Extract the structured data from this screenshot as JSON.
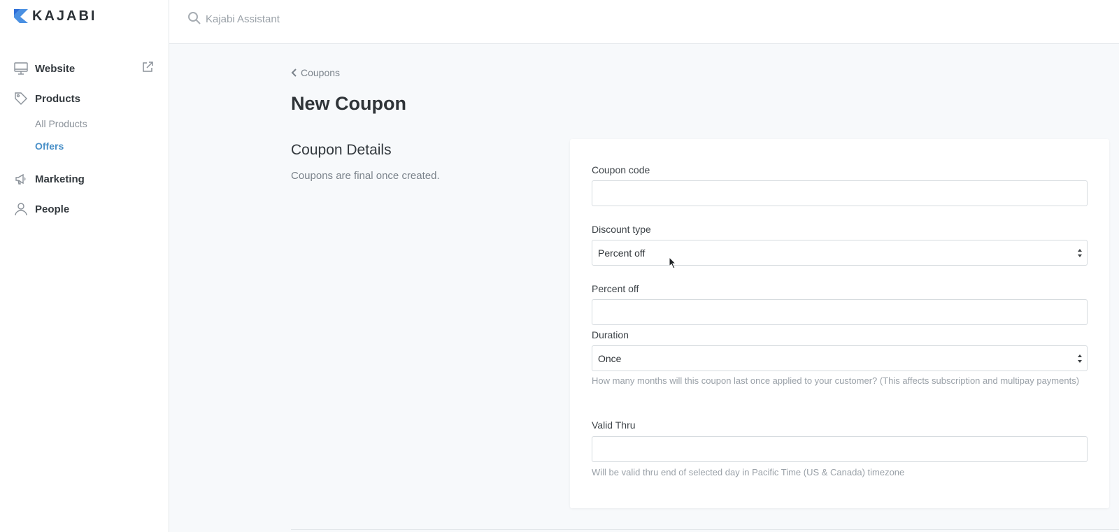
{
  "brand": {
    "name": "KAJABI",
    "color": "#4a90e2"
  },
  "search": {
    "placeholder": "Kajabi Assistant",
    "icon": "search-icon"
  },
  "sidebar": {
    "items": [
      {
        "label": "Website",
        "icon": "monitor-icon"
      },
      {
        "label": "Products",
        "icon": "tag-icon",
        "children": [
          {
            "label": "All Products"
          },
          {
            "label": "Offers",
            "active": true
          }
        ]
      },
      {
        "label": "Marketing",
        "icon": "megaphone-icon"
      },
      {
        "label": "People",
        "icon": "person-icon"
      }
    ]
  },
  "breadcrumb": {
    "label": "Coupons"
  },
  "page": {
    "title": "New Coupon",
    "section_title": "Coupon Details",
    "section_desc": "Coupons are final once created."
  },
  "form": {
    "coupon_code": {
      "label": "Coupon code",
      "value": ""
    },
    "discount_type": {
      "label": "Discount type",
      "value": "Percent off"
    },
    "percent_off": {
      "label": "Percent off",
      "value": ""
    },
    "duration": {
      "label": "Duration",
      "value": "Once",
      "help": "How many months will this coupon last once applied to your customer? (This affects subscription and multipay payments)"
    },
    "valid_thru": {
      "label": "Valid Thru",
      "value": "",
      "help": "Will be valid thru end of selected day in Pacific Time (US & Canada) timezone"
    }
  },
  "colors": {
    "accent": "#4a90c8",
    "page_bg": "#f7f9fb"
  }
}
